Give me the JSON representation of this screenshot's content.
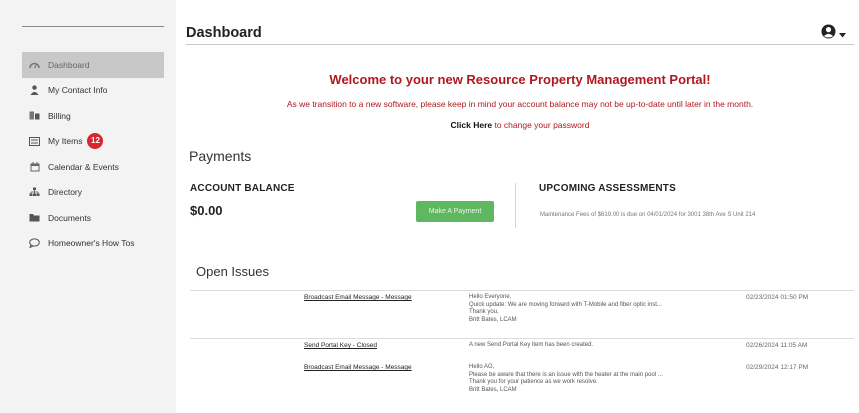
{
  "sidebar": {
    "items": [
      {
        "label": "Dashboard",
        "icon": "gauge-icon",
        "active": true
      },
      {
        "label": "My Contact Info",
        "icon": "user-icon"
      },
      {
        "label": "Billing",
        "icon": "billing-icon"
      },
      {
        "label": "My Items",
        "icon": "list-icon",
        "badge": "12"
      },
      {
        "label": "Calendar & Events",
        "icon": "calendar-icon"
      },
      {
        "label": "Directory",
        "icon": "directory-icon"
      },
      {
        "label": "Documents",
        "icon": "folder-icon"
      },
      {
        "label": "Homeowner's How Tos",
        "icon": "chat-bubble-icon"
      }
    ]
  },
  "header": {
    "title": "Dashboard",
    "user_icon": "user-circle-icon",
    "caret_icon": "caret-down-icon"
  },
  "welcome": {
    "title": "Welcome to your new Resource Property Management Portal!",
    "note": "As we transition to a new software, please keep in mind your account balance may not be up-to-date until later in the month.",
    "link_text": "Click Here",
    "link_suffix": " to change your password"
  },
  "payments": {
    "heading": "Payments",
    "balance_label": "ACCOUNT BALANCE",
    "balance_amount": "$0.00",
    "pay_button": "Make A Payment",
    "upcoming_label": "UPCOMING ASSESSMENTS",
    "upcoming_text": "Maintenance Fees of $619.00 is due on 04/01/2024 for 3001 38th Ave S Unit 214"
  },
  "issues": {
    "heading": "Open Issues",
    "rows": [
      {
        "title": "Broadcast Email Message - Message",
        "body": [
          "Hello Everyone,",
          "Quick update: We are moving forward with T-Mobile and fiber optic inst...",
          "Thank you,",
          "Britt Bates, LCAM"
        ],
        "date": "02/23/2024 01:50 PM"
      },
      {
        "title": "Send Portal Key - Closed",
        "body": [
          "A new Send Portal Key item has been created."
        ],
        "date": "02/26/2024 11:05 AM"
      },
      {
        "title": "Broadcast Email Message - Message",
        "body": [
          "Hello AG,",
          "Please be aware that there is an issue with the heater at the main pool ...",
          "Thank you for your patience as we work resolve.",
          "Britt Bates, LCAM"
        ],
        "date": "02/29/2024 12:17 PM"
      }
    ]
  },
  "colors": {
    "accent_red": "#b0181e",
    "badge_red": "#d9252e",
    "pay_green": "#5fb85f",
    "active_nav": "#c8c8c8"
  }
}
